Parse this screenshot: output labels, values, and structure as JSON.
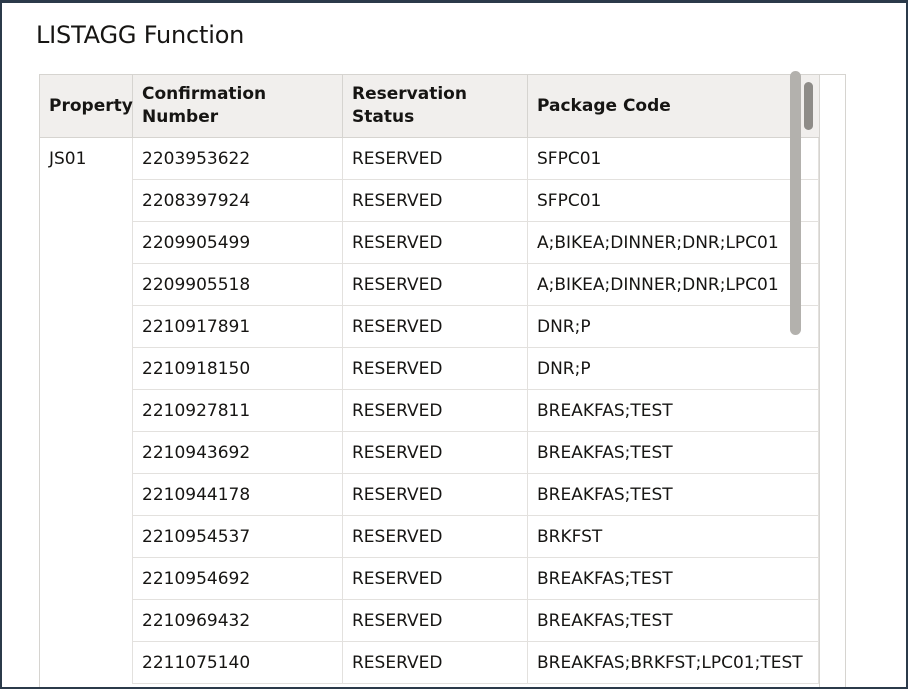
{
  "title": "LISTAGG Function",
  "table": {
    "columns": [
      "Property",
      "Confirmation\nNumber",
      "Reservation\nStatus",
      "Package Code"
    ],
    "property_value": "JS01",
    "rows": [
      {
        "confirmation": "2203953622",
        "status": "RESERVED",
        "package": "SFPC01"
      },
      {
        "confirmation": "2208397924",
        "status": "RESERVED",
        "package": "SFPC01"
      },
      {
        "confirmation": "2209905499",
        "status": "RESERVED",
        "package": "A;BIKEA;DINNER;DNR;LPC01"
      },
      {
        "confirmation": "2209905518",
        "status": "RESERVED",
        "package": "A;BIKEA;DINNER;DNR;LPC01"
      },
      {
        "confirmation": "2210917891",
        "status": "RESERVED",
        "package": "DNR;P"
      },
      {
        "confirmation": "2210918150",
        "status": "RESERVED",
        "package": "DNR;P"
      },
      {
        "confirmation": "2210927811",
        "status": "RESERVED",
        "package": "BREAKFAS;TEST"
      },
      {
        "confirmation": "2210943692",
        "status": "RESERVED",
        "package": "BREAKFAS;TEST"
      },
      {
        "confirmation": "2210944178",
        "status": "RESERVED",
        "package": "BREAKFAS;TEST"
      },
      {
        "confirmation": "2210954537",
        "status": "RESERVED",
        "package": "BRKFST"
      },
      {
        "confirmation": "2210954692",
        "status": "RESERVED",
        "package": "BREAKFAS;TEST"
      },
      {
        "confirmation": "2210969432",
        "status": "RESERVED",
        "package": "BREAKFAS;TEST"
      },
      {
        "confirmation": "2211075140",
        "status": "RESERVED",
        "package": "BREAKFAS;BRKFST;LPC01;TEST"
      }
    ]
  },
  "colors": {
    "header_bg": "#f1efed",
    "border": "#d6d4d0",
    "frame": "#2b3a4a",
    "text": "#161513"
  }
}
